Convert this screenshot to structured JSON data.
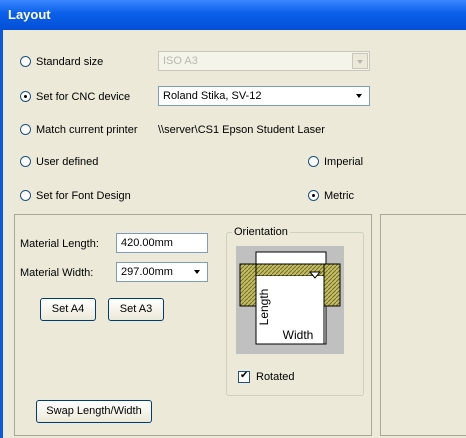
{
  "window": {
    "title": "Layout"
  },
  "size_options": {
    "standard_size": {
      "label": "Standard size",
      "selected": false,
      "combo_value": "ISO A3"
    },
    "cnc_device": {
      "label": "Set for CNC device",
      "selected": true,
      "combo_value": "Roland Stika, SV-12"
    },
    "match_printer": {
      "label": "Match current printer",
      "selected": false,
      "printer_name": "\\\\server\\CS1 Epson Student Laser"
    },
    "user_defined": {
      "label": "User defined",
      "selected": false
    },
    "font_design": {
      "label": "Set for Font Design",
      "selected": false
    }
  },
  "units": {
    "imperial": {
      "label": "Imperial",
      "selected": false
    },
    "metric": {
      "label": "Metric",
      "selected": true
    }
  },
  "material": {
    "length_label": "Material Length:",
    "length_value": "420.00mm",
    "width_label": "Material Width:",
    "width_value": "297.00mm"
  },
  "buttons": {
    "set_a4": "Set A4",
    "set_a3": "Set A3",
    "swap": "Swap Length/Width"
  },
  "orientation": {
    "group_label": "Orientation",
    "length_text": "Length",
    "width_text": "Width",
    "rotated_label": "Rotated",
    "rotated_checked": true
  }
}
